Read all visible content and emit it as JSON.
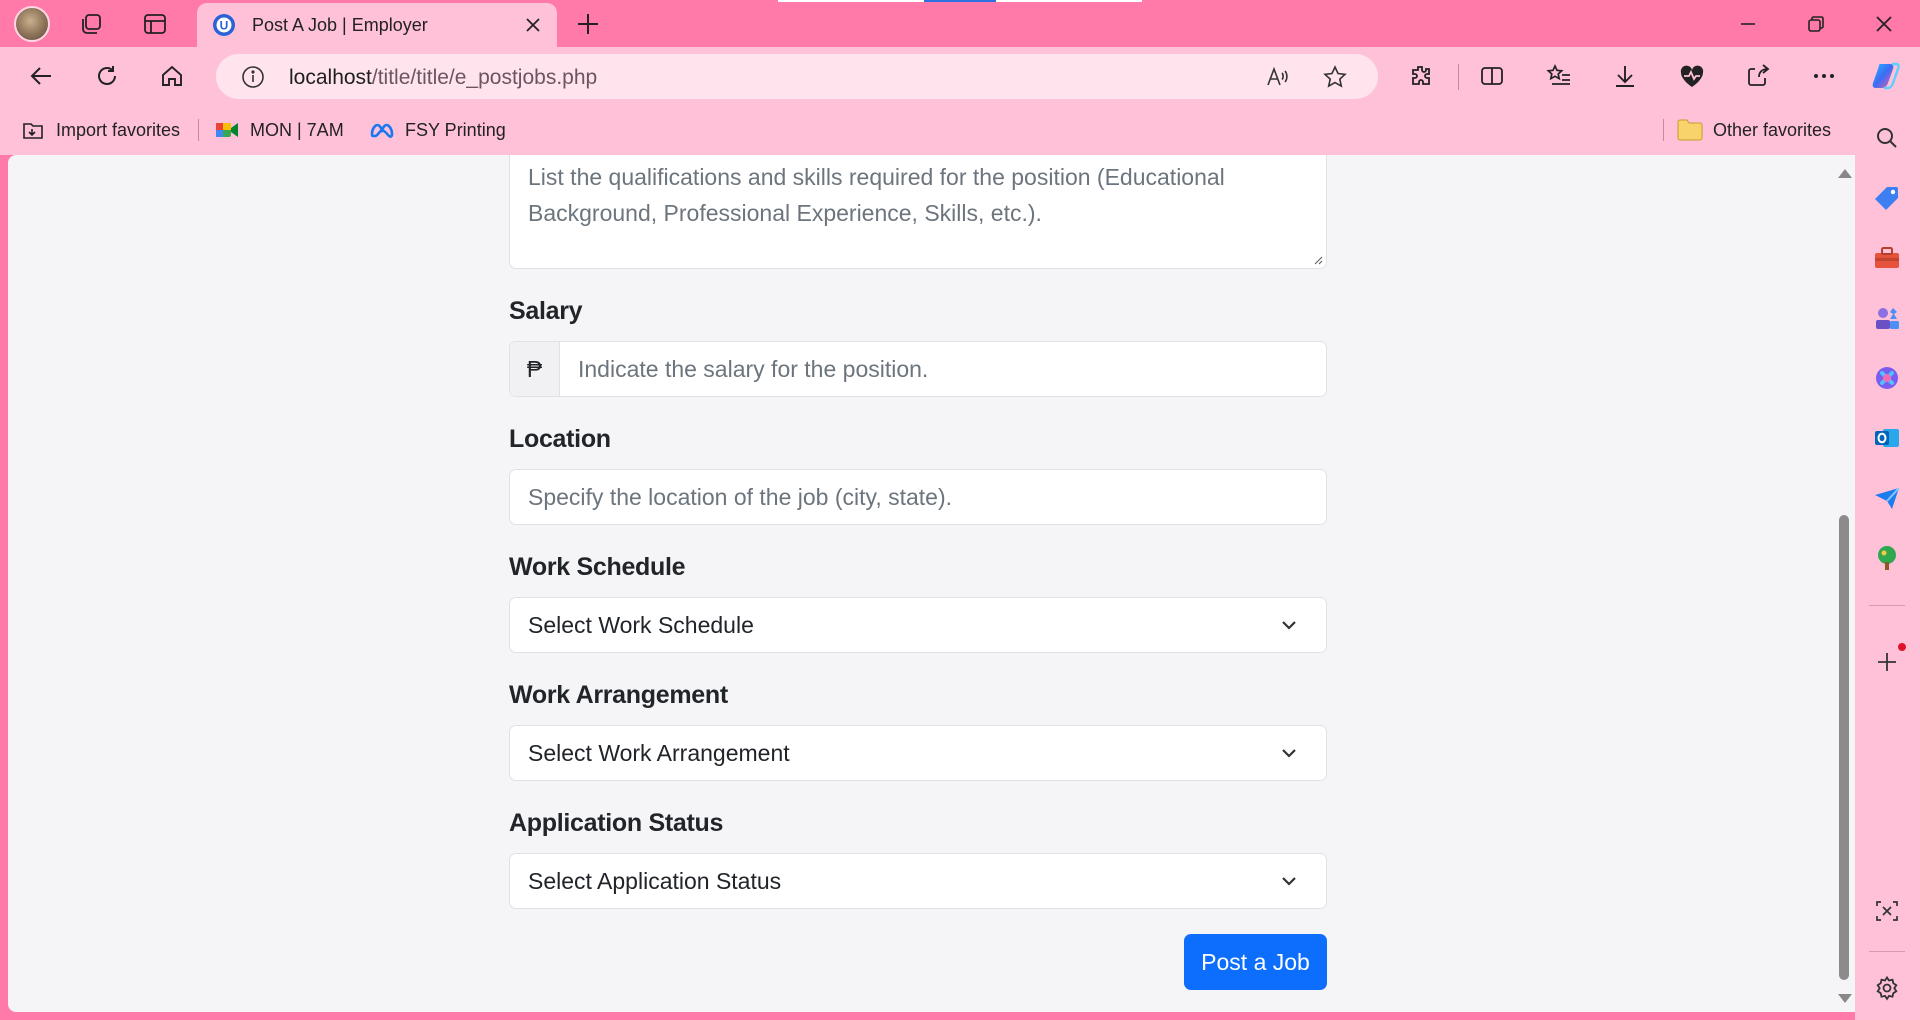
{
  "browser": {
    "tab_title": "Post A Job | Employer",
    "url_host": "localhost",
    "url_path": "/title/title/e_postjobs.php"
  },
  "favorites": {
    "import": "Import favorites",
    "item1": "MON | 7AM",
    "item2": "FSY Printing",
    "other": "Other favorites"
  },
  "form": {
    "qualifications_placeholder": "List the qualifications and skills required for the position (Educational Background, Professional Experience, Skills, etc.).",
    "salary_label": "Salary",
    "salary_prefix": "₱",
    "salary_placeholder": "Indicate the salary for the position.",
    "location_label": "Location",
    "location_placeholder": "Specify the location of the job (city, state).",
    "work_schedule_label": "Work Schedule",
    "work_schedule_value": "Select Work Schedule",
    "work_arrangement_label": "Work Arrangement",
    "work_arrangement_value": "Select Work Arrangement",
    "application_status_label": "Application Status",
    "application_status_value": "Select Application Status",
    "submit_label": "Post a Job"
  },
  "colors": {
    "browser_chrome": "#ff7aa9",
    "toolbar": "#ffc1d8",
    "primary_button": "#0d6efd"
  }
}
